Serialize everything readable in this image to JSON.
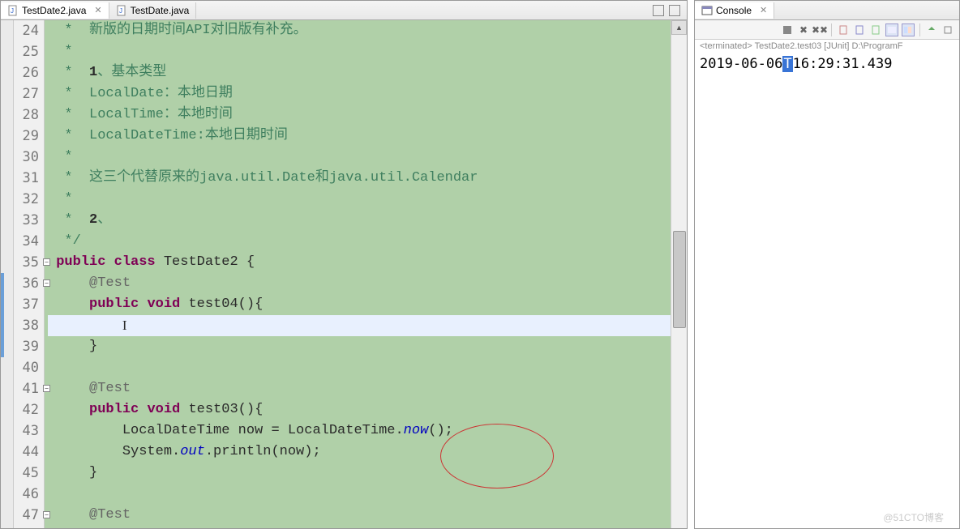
{
  "editor": {
    "tabs": [
      {
        "label": "TestDate2.java",
        "active": true
      },
      {
        "label": "TestDate.java",
        "active": false
      }
    ],
    "lines": [
      {
        "n": 24,
        "html": "  <span class='comment'>* &nbsp;新版的日期时间API对旧版有补充。</span>"
      },
      {
        "n": 25,
        "html": "  <span class='comment'>*</span>"
      },
      {
        "n": 26,
        "html": "  <span class='comment'>* &nbsp;<span class='num'>1</span>、基本类型</span>"
      },
      {
        "n": 27,
        "html": "  <span class='comment'>* &nbsp;LocalDate：本地日期</span>"
      },
      {
        "n": 28,
        "html": "  <span class='comment'>* &nbsp;LocalTime：本地时间</span>"
      },
      {
        "n": 29,
        "html": "  <span class='comment'>* &nbsp;LocalDateTime:本地日期时间</span>"
      },
      {
        "n": 30,
        "html": "  <span class='comment'>*</span>"
      },
      {
        "n": 31,
        "html": "  <span class='comment'>* &nbsp;这三个代替原来的java.util.Date和java.util.Calendar</span>"
      },
      {
        "n": 32,
        "html": "  <span class='comment'>*</span>"
      },
      {
        "n": 33,
        "html": "  <span class='comment'>* &nbsp;<span class='num'>2</span>、</span>"
      },
      {
        "n": 34,
        "html": "  <span class='comment'>*/</span>"
      },
      {
        "n": 35,
        "fold": true,
        "html": " <span class='kw'>public</span> <span class='kw'>class</span> <span class='type'>TestDate2</span> {"
      },
      {
        "n": 36,
        "fold": true,
        "blue": true,
        "html": "     <span class='ann'>@Test</span>"
      },
      {
        "n": 37,
        "blue": true,
        "html": "     <span class='kw'>public</span> <span class='kw'>void</span> test04(){"
      },
      {
        "n": 38,
        "blue": true,
        "current": true,
        "html": "         <span class='ibeam'>I</span>"
      },
      {
        "n": 39,
        "blue": true,
        "html": "     }"
      },
      {
        "n": 40,
        "html": ""
      },
      {
        "n": 41,
        "fold": true,
        "html": "     <span class='ann'>@Test</span>"
      },
      {
        "n": 42,
        "html": "     <span class='kw'>public</span> <span class='kw'>void</span> test03(){"
      },
      {
        "n": 43,
        "html": "         LocalDateTime now = LocalDateTime.<span class='static-ref'>now</span>();"
      },
      {
        "n": 44,
        "html": "         System.<span class='static-ref'>out</span>.println(now);"
      },
      {
        "n": 45,
        "html": "     }"
      },
      {
        "n": 46,
        "html": ""
      },
      {
        "n": 47,
        "fold": true,
        "html": "     <span class='ann'>@Test</span>"
      }
    ]
  },
  "console": {
    "title": "Console",
    "status": "<terminated> TestDate2.test03 [JUnit] D:\\ProgramF",
    "output_before": "2019-06-06",
    "output_hl": "T",
    "output_after": "16:29:31.439"
  },
  "watermark": "@51CTO博客"
}
